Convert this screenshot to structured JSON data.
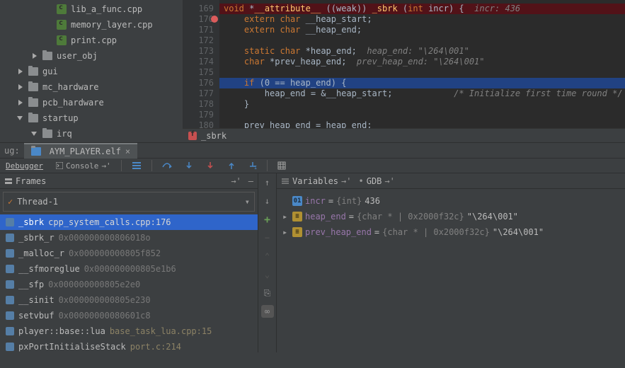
{
  "tree": {
    "files": [
      {
        "pad": 80,
        "icon": "file",
        "label": "lib_a_func.cpp"
      },
      {
        "pad": 80,
        "icon": "file",
        "label": "memory_layer.cpp"
      },
      {
        "pad": 80,
        "icon": "file",
        "label": "print.cpp"
      },
      {
        "pad": 44,
        "icon": "folder",
        "chev": "right",
        "label": "user_obj"
      },
      {
        "pad": 24,
        "icon": "folder",
        "chev": "right",
        "label": "gui"
      },
      {
        "pad": 24,
        "icon": "folder",
        "chev": "right",
        "label": "mc_hardware"
      },
      {
        "pad": 24,
        "icon": "folder",
        "chev": "right",
        "label": "pcb_hardware"
      },
      {
        "pad": 24,
        "icon": "folder",
        "chev": "down",
        "label": "startup"
      },
      {
        "pad": 44,
        "icon": "folder",
        "chev": "down",
        "label": "irq"
      }
    ]
  },
  "editor": {
    "first_line": 169,
    "breakpoint_line": 170,
    "breadcrumb": "_sbrk",
    "lines": [
      {
        "cls": "hl-line",
        "html": "<span class='kw'>void</span> <span class='op'>*</span><span class='fn'>__attribute__</span> <span class='op'>((weak))</span> <span class='fn'>_sbrk</span> <span class='op'>(</span><span class='kw'>int</span> <span class='id'>incr</span><span class='op'>) {</span>  <span class='cmt'>incr: 436</span>"
      },
      {
        "pad": "    ",
        "html": "<span class='kw'>extern</span> <span class='kw'>char</span> <span class='id'>__heap_start</span><span class='op'>;</span>"
      },
      {
        "pad": "    ",
        "html": "<span class='kw'>extern</span> <span class='kw'>char</span> <span class='id'>__heap_end</span><span class='op'>;</span>"
      },
      {
        "pad": "",
        "html": ""
      },
      {
        "pad": "    ",
        "html": "<span class='kw'>static</span> <span class='kw'>char</span> <span class='op'>*</span><span class='id'>heap_end</span><span class='op'>;</span>  <span class='cmt'>heap_end: \"\\264\\001\"</span>"
      },
      {
        "pad": "    ",
        "html": "<span class='kw'>char</span> <span class='op'>*</span><span class='id'>prev_heap_end</span><span class='op'>;</span>  <span class='cmt'>prev_heap_end: \"\\264\\001\"</span>"
      },
      {
        "pad": "",
        "html": ""
      },
      {
        "cls": "hl-sel",
        "pad": "    ",
        "html": "<span class='kw'>if</span> <span class='op'>(</span><span class='txt'>0 == heap_end</span><span class='op'>) {</span>"
      },
      {
        "pad": "        ",
        "html": "<span class='txt'>heap_end = &amp;__heap_start;</span>            <span class='cmt'>/* Initialize first time round */</span>"
      },
      {
        "pad": "    ",
        "html": "<span class='op'>}</span>"
      },
      {
        "pad": "",
        "html": ""
      },
      {
        "pad": "    ",
        "html": "<span class='txt'>prev heap end = heap end;</span>"
      }
    ]
  },
  "debug": {
    "tab_prefix": "ug:",
    "tab_name": "AYM_PLAYER.elf",
    "toolbar": {
      "debugger_label": "Debugger",
      "console_label": "Console"
    },
    "frames_label": "Frames",
    "thread": "Thread-1",
    "stack": [
      {
        "name": "_sbrk",
        "loc": "cpp_system_calls.cpp:176",
        "sel": true,
        "yel": true
      },
      {
        "name": "_sbrk_r",
        "loc": "0x000000000806018o",
        "sel": false
      },
      {
        "name": "_malloc_r",
        "loc": "0x000000000805f852",
        "sel": false
      },
      {
        "name": "__sfmoreglue",
        "loc": "0x000000000805e1b6",
        "sel": false
      },
      {
        "name": "__sfp",
        "loc": "0x000000000805e2e0",
        "sel": false
      },
      {
        "name": "__sinit",
        "loc": "0x000000000805e230",
        "sel": false
      },
      {
        "name": "setvbuf",
        "loc": "0x00000000080601c8",
        "sel": false
      },
      {
        "name": "player::base::lua",
        "loc": "base_task_lua.cpp:15",
        "sel": false,
        "yel": true
      },
      {
        "name": "pxPortInitialiseStack",
        "loc": "port.c:214",
        "sel": false,
        "yel": true
      }
    ]
  },
  "vars": {
    "label": "Variables",
    "gdb_label": "GDB",
    "items": [
      {
        "exp": "",
        "badge": "b-int",
        "badgeTxt": "01",
        "name": "incr",
        "eq": " = ",
        "type": "{int} ",
        "val": "436"
      },
      {
        "exp": "▸",
        "badge": "b-obj",
        "badgeTxt": "≡",
        "name": "heap_end",
        "eq": " = ",
        "type": "{char * | 0x2000f32c} ",
        "val": "\"\\264\\001\""
      },
      {
        "exp": "▸",
        "badge": "b-obj",
        "badgeTxt": "≡",
        "name": "prev_heap_end",
        "eq": " = ",
        "type": "{char * | 0x2000f32c} ",
        "val": "\"\\264\\001\""
      }
    ]
  }
}
